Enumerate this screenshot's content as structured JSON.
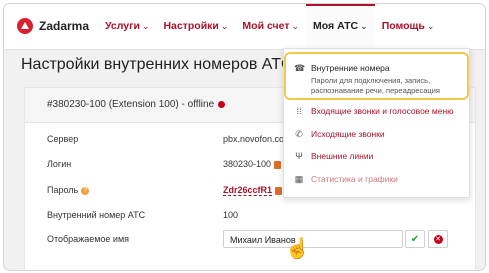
{
  "brand": "Zadarma",
  "nav": [
    {
      "label": "Услуги"
    },
    {
      "label": "Настройки"
    },
    {
      "label": "Мой счет"
    },
    {
      "label": "Моя АТС"
    },
    {
      "label": "Помощь"
    }
  ],
  "chevron": "⌄",
  "page_title": "Настройки внутренних номеров АТС",
  "extension": {
    "header": "#380230-100 (Extension 100) - offline",
    "status_color": "#c4001a",
    "server_label": "Сервер",
    "server_value": "pbx.novofon.com",
    "login_label": "Логин",
    "login_value": "380230-100",
    "password_label": "Пароль",
    "password_value": "Zdr26ccfR1",
    "pbx_number_label": "Внутренний номер АТС",
    "pbx_number_value": "100",
    "display_name_label": "Отображаемое имя",
    "display_name_value": "Михаил Иванов"
  },
  "dropdown": {
    "items": [
      {
        "label": "Внутренние номера",
        "desc": "Пароли для подключения, запись, распознавание речи, переадресация",
        "icon": "phone-icon"
      },
      {
        "label": "Входящие звонки и голосовое меню",
        "icon": "grid-icon"
      },
      {
        "label": "Исходящие звонки",
        "icon": "phone-out-icon"
      },
      {
        "label": "Внешние линии",
        "icon": "trident-icon"
      },
      {
        "label": "Статистика и графики",
        "icon": "calendar-icon"
      }
    ]
  },
  "colors": {
    "accent": "#a8132a",
    "highlight": "#f2c94c",
    "ok": "#2a9d3d"
  }
}
